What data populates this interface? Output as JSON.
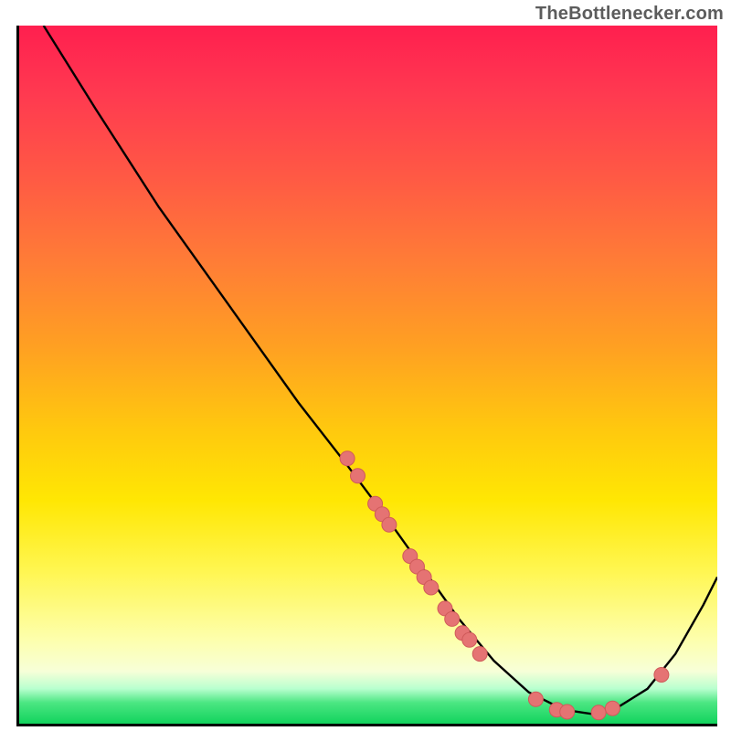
{
  "attribution": "TheBottlenecker.com",
  "chart_data": {
    "type": "line",
    "title": "",
    "xlabel": "",
    "ylabel": "",
    "xlim": [
      0,
      100
    ],
    "ylim": [
      0,
      100
    ],
    "curve": {
      "name": "bottleneck-curve",
      "points": [
        {
          "x": 3.5,
          "y": 100
        },
        {
          "x": 11,
          "y": 88
        },
        {
          "x": 20,
          "y": 74
        },
        {
          "x": 30,
          "y": 60
        },
        {
          "x": 40,
          "y": 46
        },
        {
          "x": 47,
          "y": 37
        },
        {
          "x": 53,
          "y": 29
        },
        {
          "x": 58,
          "y": 22
        },
        {
          "x": 63,
          "y": 15
        },
        {
          "x": 68,
          "y": 9
        },
        {
          "x": 73,
          "y": 4.5
        },
        {
          "x": 78,
          "y": 2
        },
        {
          "x": 82,
          "y": 1.4
        },
        {
          "x": 86,
          "y": 2.5
        },
        {
          "x": 90,
          "y": 5
        },
        {
          "x": 94,
          "y": 10
        },
        {
          "x": 98,
          "y": 17
        },
        {
          "x": 100,
          "y": 21
        }
      ]
    },
    "markers": [
      {
        "x": 47,
        "y": 38
      },
      {
        "x": 48.5,
        "y": 35.5
      },
      {
        "x": 51,
        "y": 31.5
      },
      {
        "x": 52,
        "y": 30
      },
      {
        "x": 53,
        "y": 28.5
      },
      {
        "x": 56,
        "y": 24
      },
      {
        "x": 57,
        "y": 22.5
      },
      {
        "x": 58,
        "y": 21
      },
      {
        "x": 59,
        "y": 19.5
      },
      {
        "x": 61,
        "y": 16.5
      },
      {
        "x": 62,
        "y": 15
      },
      {
        "x": 63.5,
        "y": 13
      },
      {
        "x": 64.5,
        "y": 12
      },
      {
        "x": 66,
        "y": 10
      },
      {
        "x": 74,
        "y": 3.5
      },
      {
        "x": 77,
        "y": 2
      },
      {
        "x": 78.5,
        "y": 1.7
      },
      {
        "x": 83,
        "y": 1.6
      },
      {
        "x": 85,
        "y": 2.2
      },
      {
        "x": 92,
        "y": 7
      }
    ],
    "marker_radius": 8,
    "colors": {
      "curve": "#000000",
      "marker_fill": "#e57373",
      "marker_stroke": "#d05a5a"
    }
  }
}
